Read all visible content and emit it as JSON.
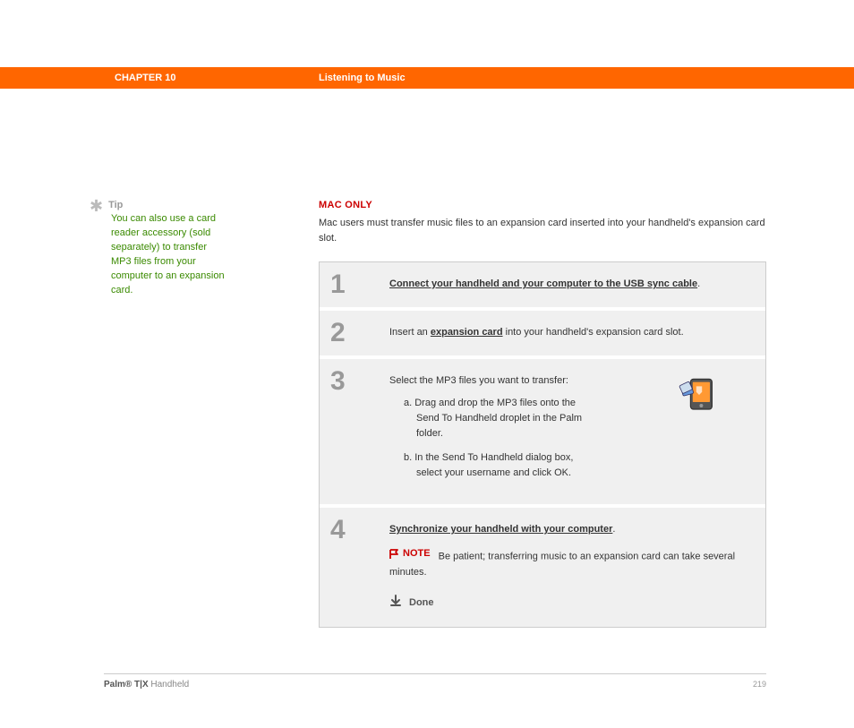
{
  "header": {
    "chapter": "CHAPTER 10",
    "title": "Listening to Music"
  },
  "tip": {
    "label": "Tip",
    "text": "You can also use a card reader accessory (sold separately) to transfer MP3 files from your computer to an expansion card."
  },
  "main": {
    "macOnly": "MAC ONLY",
    "intro": "Mac users must transfer music files to an expansion card inserted into your handheld's expansion card slot."
  },
  "steps": {
    "s1": {
      "num": "1",
      "link": "Connect your handheld and your computer to the USB sync cable",
      "after": "."
    },
    "s2": {
      "num": "2",
      "before": "Insert an ",
      "link": "expansion card",
      "after": " into your handheld's expansion card slot."
    },
    "s3": {
      "num": "3",
      "lead": "Select the MP3 files you want to transfer:",
      "a": "a.  Drag and drop the MP3 files onto the Send To Handheld droplet in the Palm folder.",
      "b": "b.  In the Send To Handheld dialog box, select your username and click OK."
    },
    "s4": {
      "num": "4",
      "link": "Synchronize your handheld with your computer",
      "after": ".",
      "noteLabel": "NOTE",
      "noteText": "Be patient; transferring music to an expansion card can take several minutes.",
      "done": "Done"
    }
  },
  "footer": {
    "productBold": "Palm® T|X",
    "productRest": " Handheld",
    "page": "219"
  }
}
